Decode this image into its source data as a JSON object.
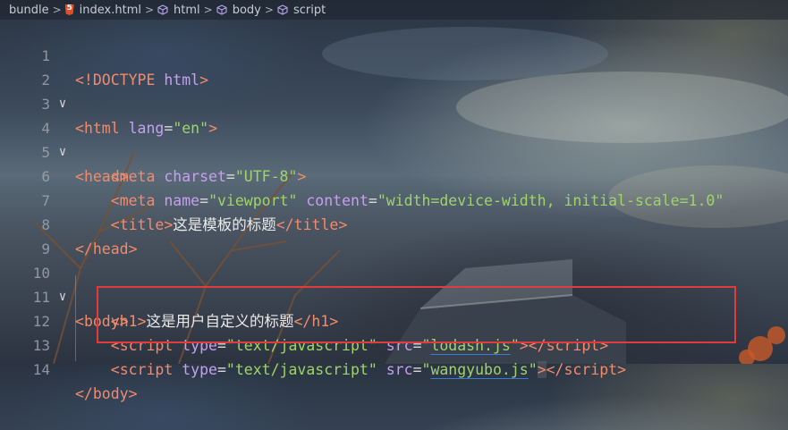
{
  "breadcrumb": {
    "items": [
      "bundle",
      "index.html",
      "html",
      "body",
      "script"
    ],
    "separator": ">"
  },
  "editor": {
    "lines": [
      {
        "num": "1"
      },
      {
        "num": "2"
      },
      {
        "num": "3"
      },
      {
        "num": "4"
      },
      {
        "num": "5"
      },
      {
        "num": "6"
      },
      {
        "num": "7"
      },
      {
        "num": "8"
      },
      {
        "num": "9"
      },
      {
        "num": "10"
      },
      {
        "num": "11"
      },
      {
        "num": "12"
      },
      {
        "num": "13"
      },
      {
        "num": "14"
      }
    ],
    "tokens": {
      "doctype_open": "<!DOCTYPE",
      "doctype_html": " html",
      "doctype_close": ">",
      "html": "html",
      "lang": "lang",
      "en": "\"en\"",
      "head": "head",
      "meta": "meta",
      "charset": "charset",
      "utf8": "\"UTF-8\"",
      "name": "name",
      "viewport": "\"viewport\"",
      "content": "content",
      "content_val": "\"width=device-width, initial-scale=1.0\"",
      "title": "title",
      "title_text": "这是模板的标题",
      "body": "body",
      "h1": "h1",
      "h1_text": "这是用户自定义的标题",
      "script": "script",
      "type": "type",
      "type_val": "\"text/javascript\"",
      "src": "src",
      "lodash_q1": "\"",
      "lodash": "lodash.js",
      "lodash_q2": "\"",
      "wangyubo_q1": "\"",
      "wangyubo": "wangyubo.js",
      "wangyubo_q2": "\""
    },
    "colors": {
      "tag": "#f28b6b",
      "attribute": "#c79ff0",
      "string": "#9fd46a",
      "highlight_border": "#e23b3b"
    }
  }
}
